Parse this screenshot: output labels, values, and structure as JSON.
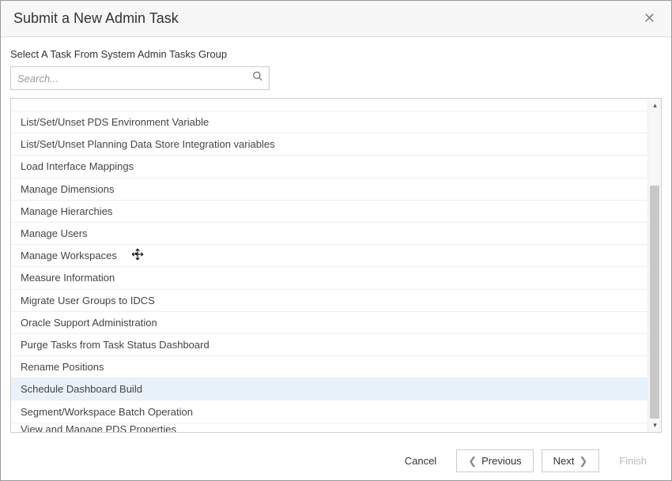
{
  "dialog": {
    "title": "Submit a New Admin Task",
    "subtitle": "Select A Task From System Admin Tasks Group"
  },
  "search": {
    "placeholder": "Search..."
  },
  "tasks": {
    "items": [
      "List/Set/Unset PDS Environment Variable",
      "List/Set/Unset Planning Data Store Integration variables",
      "Load Interface Mappings",
      "Manage Dimensions",
      "Manage Hierarchies",
      "Manage Users",
      "Manage Workspaces",
      "Measure Information",
      "Migrate User Groups to IDCS",
      "Oracle Support Administration",
      "Purge Tasks from Task Status Dashboard",
      "Rename Positions",
      "Schedule Dashboard Build",
      "Segment/Workspace Batch Operation",
      "View and Manage PDS Properties"
    ],
    "selected_index": 12
  },
  "footer": {
    "cancel": "Cancel",
    "previous": "Previous",
    "next": "Next",
    "finish": "Finish"
  }
}
